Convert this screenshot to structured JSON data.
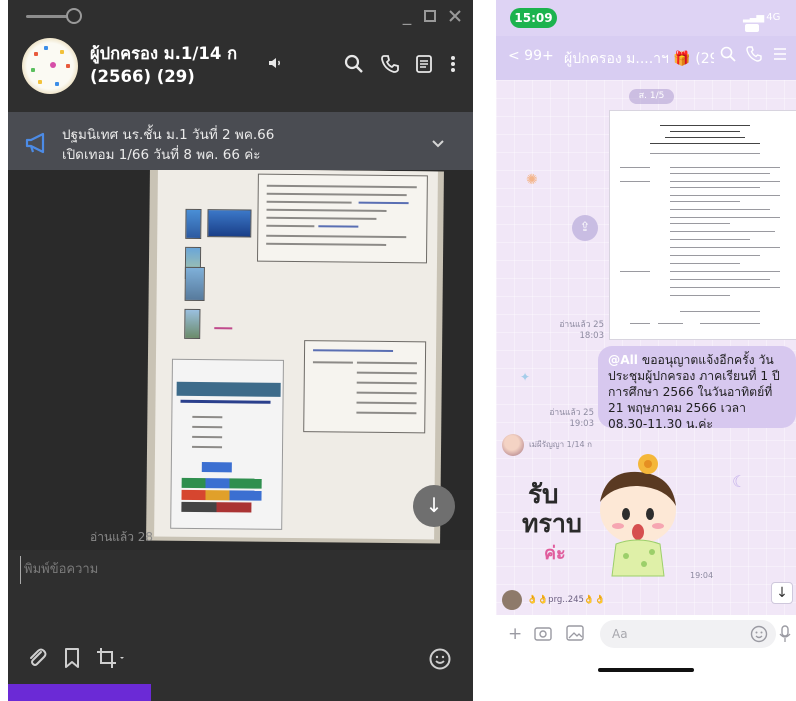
{
  "desktop": {
    "group_title_line1": "ผู้ปกครอง ม.1/14 ก",
    "group_title_line2": "(2566) (29)",
    "announcement_line1": "ปฐมนิเทศ นร.ชั้น ม.1 วันที่ 2 พค.66",
    "announcement_line2": "เปิดเทอม 1/66 วันที่ 8 พค. 66 ค่ะ",
    "read_receipt": "อ่านแล้ว 28",
    "input_placeholder": "พิมพ์ข้อความ",
    "icons": {
      "pin": "pin-icon",
      "minimize": "minimize-icon",
      "maximize": "maximize-icon",
      "close": "close-icon",
      "volume": "volume-icon",
      "search": "search-icon",
      "call": "phone-icon",
      "notes": "notes-icon",
      "more": "more-icon",
      "megaphone": "megaphone-icon",
      "expand": "chevron-down-icon",
      "scroll_down": "arrow-down-icon",
      "attach": "paperclip-icon",
      "bookmark": "bookmark-icon",
      "crop": "crop-icon",
      "emoji": "emoji-icon"
    },
    "colors": {
      "window_bg": "#2f2f2f",
      "announce_bg": "#4a4c52",
      "accent_tab": "#6b2ad6"
    }
  },
  "mobile": {
    "status_time": "15:09",
    "network": "4G",
    "back_label": "< 99+",
    "chat_title": "ผู้ปกครอง ม....าฯ 🎁 (29)",
    "date_chip": "ส. 1/5",
    "doc_read": "อ่านแล้ว 25",
    "doc_time": "18:03",
    "message_mention": "@All",
    "message_text": "ขออนุญาตแจ้งอีกครั้ง วันประชุมผู้ปกครอง ภาคเรียนที่ 1 ปีการศึกษา 2566 ในวันอาทิตย์ที่ 21 พฤษภาคม 2566 เวลา 08.30-11.30 น.ค่ะ",
    "message_read": "อ่านแล้ว 25",
    "message_time": "19:03",
    "sender_name": "เม่ผีรัญญา 1/14 ก",
    "sticker_text_1": "รับ",
    "sticker_text_2": "ทราบ",
    "sticker_text_3": "ค่ะ",
    "sticker_time": "19:04",
    "last_message_preview": "👌👌prg..245👌👌",
    "input_placeholder": "Aa",
    "colors": {
      "time_pill": "#1cb34e",
      "header": "#d8cdf2",
      "bubble": "#d7c8ef"
    }
  }
}
